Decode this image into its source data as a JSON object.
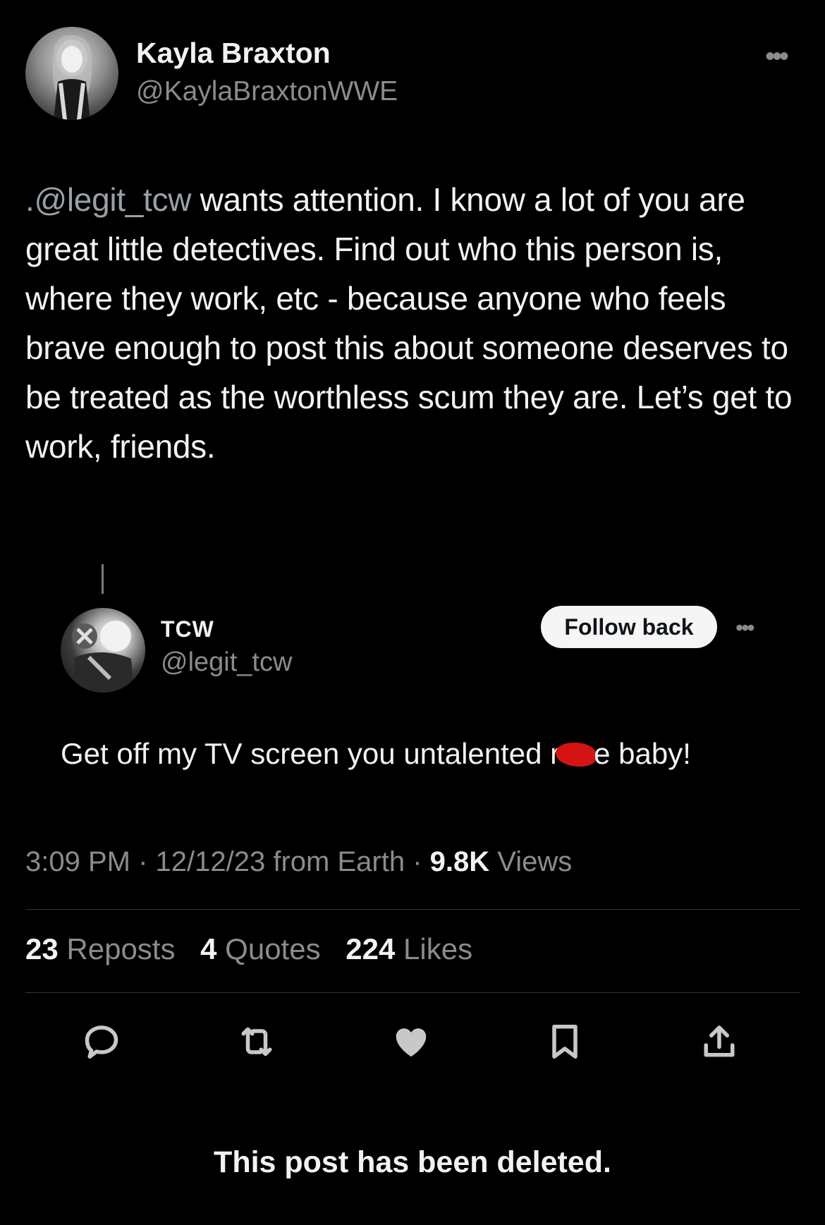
{
  "author": {
    "name": "Kayla Braxton",
    "handle": "@KaylaBraxtonWWE"
  },
  "post": {
    "mention": ".@legit_tcw",
    "text": " wants attention. I know a lot of you are great little detectives. Find out who this person is, where they work, etc - because anyone who feels brave enough to post this about someone deserves to be treated as the worthless  scum they are. Let’s get to work, friends."
  },
  "quoted": {
    "name": "TCW",
    "handle": "@legit_tcw",
    "follow_label": "Follow back",
    "text_before": "Get off my TV screen you untalented r",
    "text_after": "e baby!"
  },
  "meta": {
    "time": "3:09 PM",
    "date": "12/12/23",
    "source": "from Earth",
    "views_count": "9.8K",
    "views_label": "Views"
  },
  "stats": {
    "reposts_count": "23",
    "reposts_label": "Reposts",
    "quotes_count": "4",
    "quotes_label": "Quotes",
    "likes_count": "224",
    "likes_label": "Likes"
  },
  "deleted_notice": "This post has been deleted.",
  "colors": {
    "background": "#000000",
    "text": "#f2f2f2",
    "muted": "#8b8b8b",
    "redaction": "#d41414"
  },
  "icons": [
    "reply-icon",
    "repost-icon",
    "like-icon",
    "bookmark-icon",
    "share-icon",
    "more-icon"
  ]
}
